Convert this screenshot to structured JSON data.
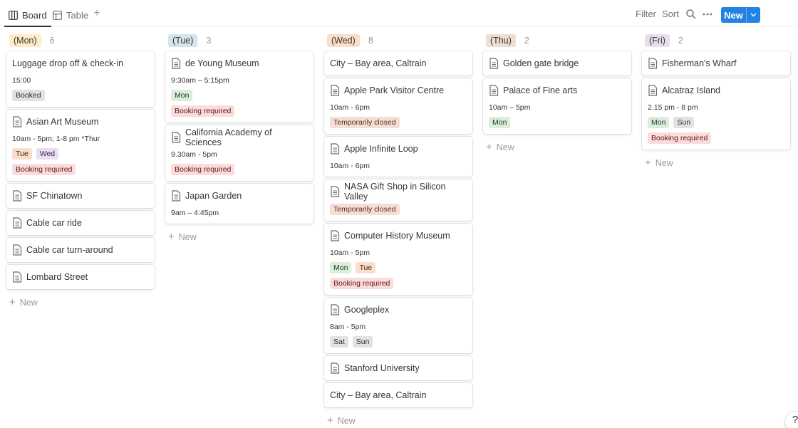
{
  "toolbar": {
    "views": [
      {
        "label": "Board",
        "icon": "board-icon",
        "active": true
      },
      {
        "label": "Table",
        "icon": "table-icon",
        "active": false
      }
    ],
    "filter_label": "Filter",
    "sort_label": "Sort",
    "new_label": "New"
  },
  "colors": {
    "accent": "#2383e2",
    "mon": "#fdecc8",
    "tue": "#d3e5ef",
    "wed": "#fadec9",
    "thu": "#f0ddd3",
    "fri": "#e8deee"
  },
  "add_new_label": "New",
  "columns": [
    {
      "tag": "(Mon)",
      "count": "6",
      "cards": [
        {
          "title": "Luggage drop off & check-in",
          "icon": false,
          "prop": "15:00",
          "tags": [
            [
              "Booked"
            ]
          ]
        },
        {
          "title": "Asian Art Museum",
          "icon": true,
          "prop": "10am - 5pm; 1-8 pm *Thur",
          "tags": [
            [
              "Tue",
              "Wed"
            ],
            [
              "Booking required"
            ]
          ]
        },
        {
          "title": "SF Chinatown",
          "icon": true
        },
        {
          "title": "Cable car ride",
          "icon": true
        },
        {
          "title": "Cable car turn-around",
          "icon": true
        },
        {
          "title": "Lombard Street",
          "icon": true
        }
      ]
    },
    {
      "tag": "(Tue)",
      "count": "3",
      "cards": [
        {
          "title": "de Young Museum",
          "icon": true,
          "prop": "9:30am – 5:15pm",
          "tags": [
            [
              "Mon"
            ],
            [
              "Booking required"
            ]
          ]
        },
        {
          "title": "California Academy of Sciences",
          "icon": true,
          "prop": "9.30am - 5pm",
          "tags": [
            [
              "Booking required"
            ]
          ]
        },
        {
          "title": "Japan Garden",
          "icon": true,
          "prop": "9am – 4:45pm"
        }
      ]
    },
    {
      "tag": "(Wed)",
      "count": "8",
      "cards": [
        {
          "title": "City – Bay area, Caltrain",
          "icon": false
        },
        {
          "title": "Apple Park Visitor Centre",
          "icon": true,
          "prop": "10am - 6pm",
          "tags": [
            [
              "Temporarily closed"
            ]
          ]
        },
        {
          "title": "Apple Infinite Loop",
          "icon": true,
          "prop": "10am - 6pm"
        },
        {
          "title": "NASA Gift Shop in Silicon Valley",
          "icon": true,
          "tags": [
            [
              "Temporarily closed"
            ]
          ]
        },
        {
          "title": "Computer History Museum",
          "icon": true,
          "prop": "10am - 5pm",
          "tags": [
            [
              "Mon",
              "Tue"
            ],
            [
              "Booking required"
            ]
          ]
        },
        {
          "title": "Googleplex",
          "icon": true,
          "prop": "8am - 5pm",
          "tags": [
            [
              "Sat",
              "Sun"
            ]
          ]
        },
        {
          "title": "Stanford University",
          "icon": true
        },
        {
          "title": "City – Bay area, Caltrain",
          "icon": false
        }
      ]
    },
    {
      "tag": "(Thu)",
      "count": "2",
      "cards": [
        {
          "title": "Golden gate bridge",
          "icon": true
        },
        {
          "title": "Palace of Fine arts",
          "icon": true,
          "prop": "10am – 5pm",
          "tags": [
            [
              "Mon"
            ]
          ]
        }
      ]
    },
    {
      "tag": "(Fri)",
      "count": "2",
      "cards": [
        {
          "title": "Fisherman's Wharf",
          "icon": true
        },
        {
          "title": "Alcatraz Island",
          "icon": true,
          "prop": "2.15 pm - 8 pm",
          "tags": [
            [
              "Mon",
              "Sun"
            ],
            [
              "Booking required"
            ]
          ]
        }
      ]
    }
  ],
  "help_label": "?"
}
